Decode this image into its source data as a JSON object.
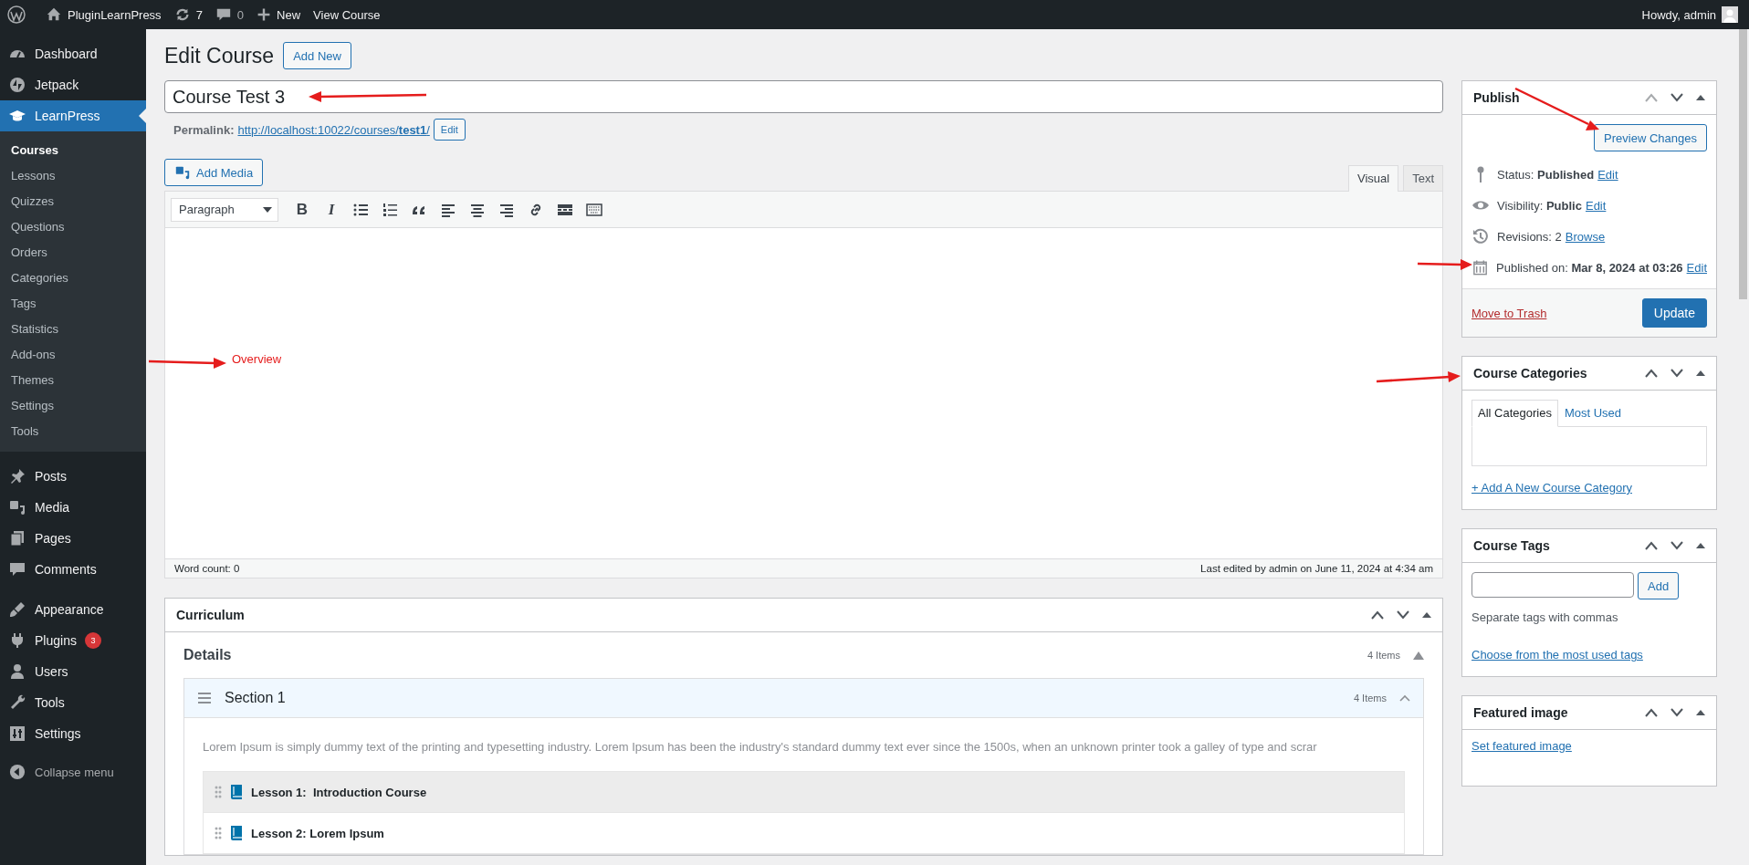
{
  "admin_bar": {
    "site_name": "PluginLearnPress",
    "updates_count": "7",
    "comments_count": "0",
    "new_label": "New",
    "view_label": "View Course",
    "greeting": "Howdy, admin"
  },
  "sidebar": {
    "groups": [
      [
        {
          "label": "Dashboard",
          "selected": false
        },
        {
          "label": "Jetpack",
          "selected": false
        },
        {
          "label": "LearnPress",
          "selected": true,
          "children": [
            {
              "label": "Courses",
              "selected": true
            },
            {
              "label": "Lessons",
              "selected": false
            },
            {
              "label": "Quizzes",
              "selected": false
            },
            {
              "label": "Questions",
              "selected": false
            },
            {
              "label": "Orders",
              "selected": false
            },
            {
              "label": "Categories",
              "selected": false
            },
            {
              "label": "Tags",
              "selected": false
            },
            {
              "label": "Statistics",
              "selected": false
            },
            {
              "label": "Add-ons",
              "selected": false
            },
            {
              "label": "Themes",
              "selected": false
            },
            {
              "label": "Settings",
              "selected": false
            },
            {
              "label": "Tools",
              "selected": false
            }
          ]
        }
      ],
      [
        {
          "label": "Posts",
          "selected": false
        },
        {
          "label": "Media",
          "selected": false
        },
        {
          "label": "Pages",
          "selected": false
        },
        {
          "label": "Comments",
          "selected": false
        }
      ],
      [
        {
          "label": "Appearance",
          "selected": false
        },
        {
          "label": "Plugins",
          "selected": false,
          "badge": "3"
        },
        {
          "label": "Users",
          "selected": false
        },
        {
          "label": "Tools",
          "selected": false
        },
        {
          "label": "Settings",
          "selected": false
        }
      ]
    ],
    "collapse_label": "Collapse menu"
  },
  "page": {
    "title": "Edit Course",
    "add_new": "Add New"
  },
  "title_field": {
    "value": "Course Test 3"
  },
  "permalink": {
    "label": "Permalink:",
    "url": "http://localhost:10022/courses/**test1**/",
    "edit": "Edit"
  },
  "editor": {
    "add_media": "Add Media",
    "tabs": [
      {
        "label": "Visual",
        "selected": true
      },
      {
        "label": "Text",
        "selected": false
      }
    ],
    "format": "Paragraph",
    "toolbar": [
      {
        "kind": "bold",
        "glyph": "B"
      },
      {
        "kind": "italic",
        "glyph": "I"
      },
      {
        "kind": "bullets"
      },
      {
        "kind": "numbers"
      },
      {
        "kind": "quote"
      },
      {
        "kind": "align-left"
      },
      {
        "kind": "align-center"
      },
      {
        "kind": "align-right"
      },
      {
        "kind": "link"
      },
      {
        "kind": "more"
      },
      {
        "kind": "toolbar-toggle"
      }
    ],
    "word_count": "Word count: 0",
    "last_edited": "Last edited by admin on June 11, 2024 at 4:34 am"
  },
  "annotation": {
    "label": "Overview"
  },
  "curriculum": {
    "title": "Curriculum",
    "details_title": "Details",
    "details_count": "4 Items",
    "sections": [
      {
        "title": "Section 1",
        "count": "4 Items",
        "description": "Lorem Ipsum is simply dummy text of the printing and typesetting industry. Lorem Ipsum has been the industry's standard dummy text ever since the 1500s, when an unknown printer took a galley of type and scrar",
        "lessons": [
          {
            "title": "Lesson 1:  Introduction Course",
            "highlighted": true
          },
          {
            "title": "Lesson 2: Lorem Ipsum",
            "highlighted": false
          }
        ]
      }
    ]
  },
  "publish": {
    "title": "Publish",
    "preview": "Preview Changes",
    "rows": [
      {
        "text": "Status: **Published**",
        "link": "Edit"
      },
      {
        "text": "Visibility: **Public**",
        "link": "Edit"
      },
      {
        "text": "Revisions: 2",
        "link": "Browse"
      },
      {
        "text": "Published on: **Mar 8, 2024 at 03:26**",
        "link": "Edit"
      }
    ],
    "trash": "Move to Trash",
    "update": "Update"
  },
  "categories": {
    "title": "Course Categories",
    "tabs": [
      {
        "label": "All Categories",
        "selected": true
      },
      {
        "label": "Most Used",
        "selected": false
      }
    ],
    "add_link": "+ Add A New Course Category"
  },
  "tags": {
    "title": "Course Tags",
    "add": "Add",
    "hint": "Separate tags with commas",
    "link": "Choose from the most used tags"
  },
  "featured": {
    "title": "Featured image",
    "link": "Set featured image"
  }
}
